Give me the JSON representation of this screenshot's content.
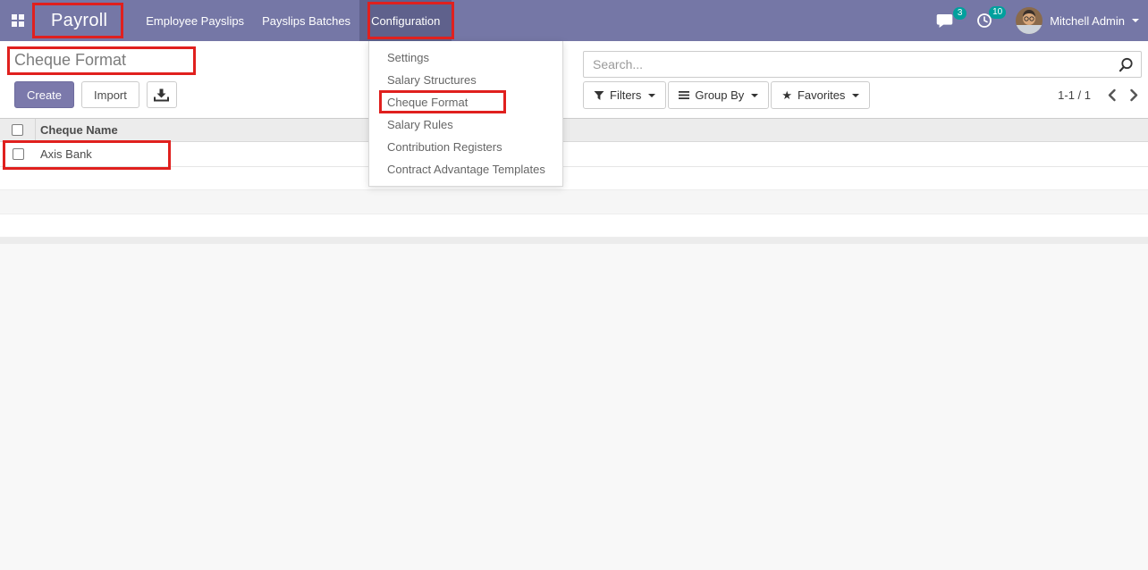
{
  "navbar": {
    "app_title": "Payroll",
    "menu": [
      {
        "label": "Employee Payslips"
      },
      {
        "label": "Payslips Batches"
      },
      {
        "label": "Configuration"
      }
    ],
    "messages_badge": "3",
    "activities_badge": "10",
    "user_name": "Mitchell Admin"
  },
  "control_panel": {
    "breadcrumb": "Cheque Format",
    "create_label": "Create",
    "import_label": "Import",
    "search": {
      "placeholder": "Search...",
      "value": ""
    },
    "filters_label": "Filters",
    "group_by_label": "Group By",
    "favorites_label": "Favorites",
    "pager": {
      "text": "1-1 / 1"
    }
  },
  "configuration_menu": {
    "items": [
      "Settings",
      "Salary Structures",
      "Cheque Format",
      "Salary Rules",
      "Contribution Registers",
      "Contract Advantage Templates"
    ],
    "highlighted_item": "Cheque Format"
  },
  "list_view": {
    "columns": [
      "Cheque Name"
    ],
    "rows": [
      {
        "cheque_name": "Axis Bank"
      }
    ]
  },
  "glyphs": {
    "favorites_star": "★"
  },
  "colors": {
    "navbar_bg": "#7577a6",
    "navbar_active_bg": "#5f618c",
    "badge_bg": "#00a09d",
    "primary_btn_bg": "#7b79ab",
    "annotation_red": "#e0201e",
    "header_row_bg": "#ececec",
    "stripe_bg": "#f6f6f6",
    "page_bg": "#f8f8f8"
  }
}
